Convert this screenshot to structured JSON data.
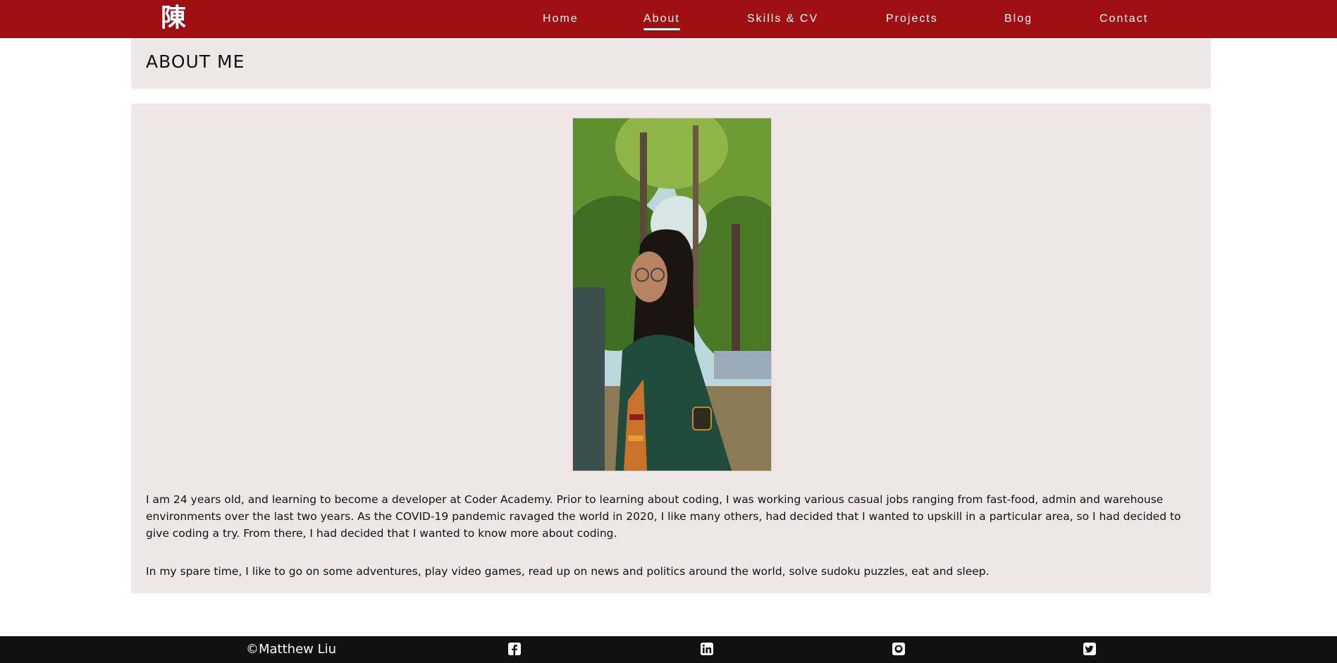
{
  "header": {
    "logo_text": "陳",
    "nav": [
      {
        "label": "Home",
        "active": false
      },
      {
        "label": "About",
        "active": true
      },
      {
        "label": "Skills & CV",
        "active": false
      },
      {
        "label": "Projects",
        "active": false
      },
      {
        "label": "Blog",
        "active": false
      },
      {
        "label": "Contact",
        "active": false
      }
    ]
  },
  "page": {
    "title": "ABOUT ME"
  },
  "about": {
    "paragraphs": [
      "I am 24 years old, and learning to become a developer at Coder Academy. Prior to learning about coding, I was working various casual jobs ranging from fast-food, admin and warehouse environments over the last two years. As the COVID-19 pandemic ravaged the world in 2020, I like many others, had decided that I wanted to upskill in a particular area, so I had decided to give coding a try. From there, I had decided that I wanted to know more about coding.",
      "In my spare time, I like to go on some adventures, play video games, read up on news and politics around the world, solve sudoku puzzles, eat and sleep."
    ]
  },
  "footer": {
    "copyright": "©Matthew Liu",
    "social_icons": [
      "facebook-icon",
      "linkedin-icon",
      "github-icon",
      "twitter-icon"
    ]
  },
  "colors": {
    "brand_red": "#a01012",
    "card_bg": "#efe6e8",
    "footer_bg": "#111111"
  }
}
